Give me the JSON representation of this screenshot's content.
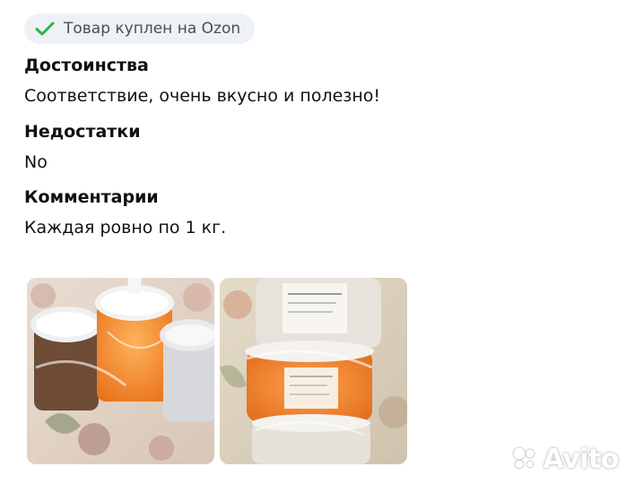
{
  "badge": {
    "text": "Товар куплен на Ozon",
    "icon": "check-icon",
    "icon_color": "#2fb34a",
    "background": "#eef1f5"
  },
  "review": {
    "pros_title": "Достоинства",
    "pros_text": "Соответствие, очень вкусно и полезно!",
    "cons_title": "Недостатки",
    "cons_text": "No",
    "comments_title": "Комментарии",
    "comments_text": "Каждая ровно по 1 кг."
  },
  "photos": [
    {
      "name": "review-photo-1"
    },
    {
      "name": "review-photo-2"
    }
  ],
  "watermark": {
    "text": "Avito",
    "icon": "avito-logo-icon"
  }
}
